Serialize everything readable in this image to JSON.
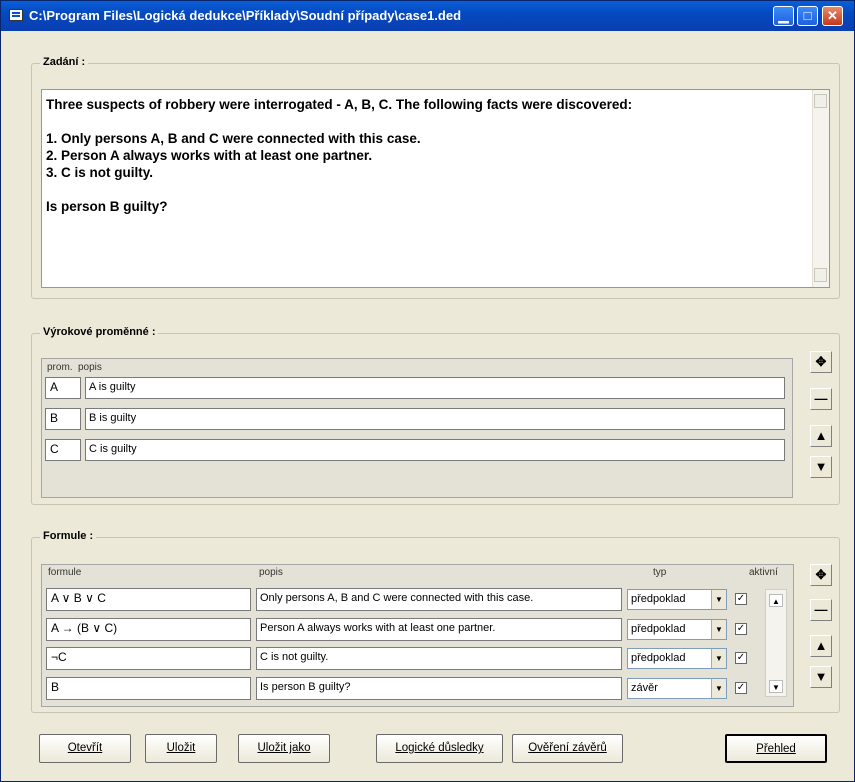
{
  "window": {
    "title": "C:\\Program Files\\Logická dedukce\\Příklady\\Soudní případy\\case1.ded"
  },
  "titlebar_buttons": {
    "minimize": "▁",
    "maximize": "□",
    "close": "✕"
  },
  "assignment": {
    "label": "Zadání :",
    "text": "Three suspects of robbery were interrogated - A, B, C. The following facts were discovered:\n\n1. Only persons A, B and C were connected with this case.\n2. Person A always works with at least one partner.\n3. C is not guilty.\n\nIs person B guilty?"
  },
  "variables": {
    "label": "Výrokové proměnné :",
    "col_prom": "prom.",
    "col_popis": "popis",
    "rows": [
      {
        "prom": "A",
        "popis": "A is guilty"
      },
      {
        "prom": "B",
        "popis": "B is guilty"
      },
      {
        "prom": "C",
        "popis": "C is guilty"
      }
    ]
  },
  "formulas": {
    "label": "Formule :",
    "col_formule": "formule",
    "col_popis": "popis",
    "col_typ": "typ",
    "col_aktivni": "aktivní",
    "rows": [
      {
        "formula": "A ∨ B ∨ C",
        "popis": "Only persons A, B and C were connected with this case.",
        "typ": "předpoklad",
        "aktivni": true
      },
      {
        "formula": "A → (B ∨ C)",
        "popis": "Person A always works with at least one partner.",
        "typ": "předpoklad",
        "aktivni": true
      },
      {
        "formula": "¬C",
        "popis": "C is not guilty.",
        "typ": "předpoklad",
        "aktivni": true
      },
      {
        "formula": "B",
        "popis": "Is person B guilty?",
        "typ": "závěr",
        "aktivni": true
      }
    ]
  },
  "side_buttons": {
    "add": "✥",
    "remove": "—",
    "up": "▲",
    "down": "▼"
  },
  "buttons": {
    "open": "Otevřít",
    "save": "Uložit",
    "save_as": "Uložit jako",
    "consequences": "Logické důsledky",
    "verify": "Ověření závěrů",
    "overview": "Přehled"
  },
  "icons": {
    "check": "✓",
    "drop": "▼",
    "scroll_up": "▲",
    "scroll_down": "▼"
  }
}
